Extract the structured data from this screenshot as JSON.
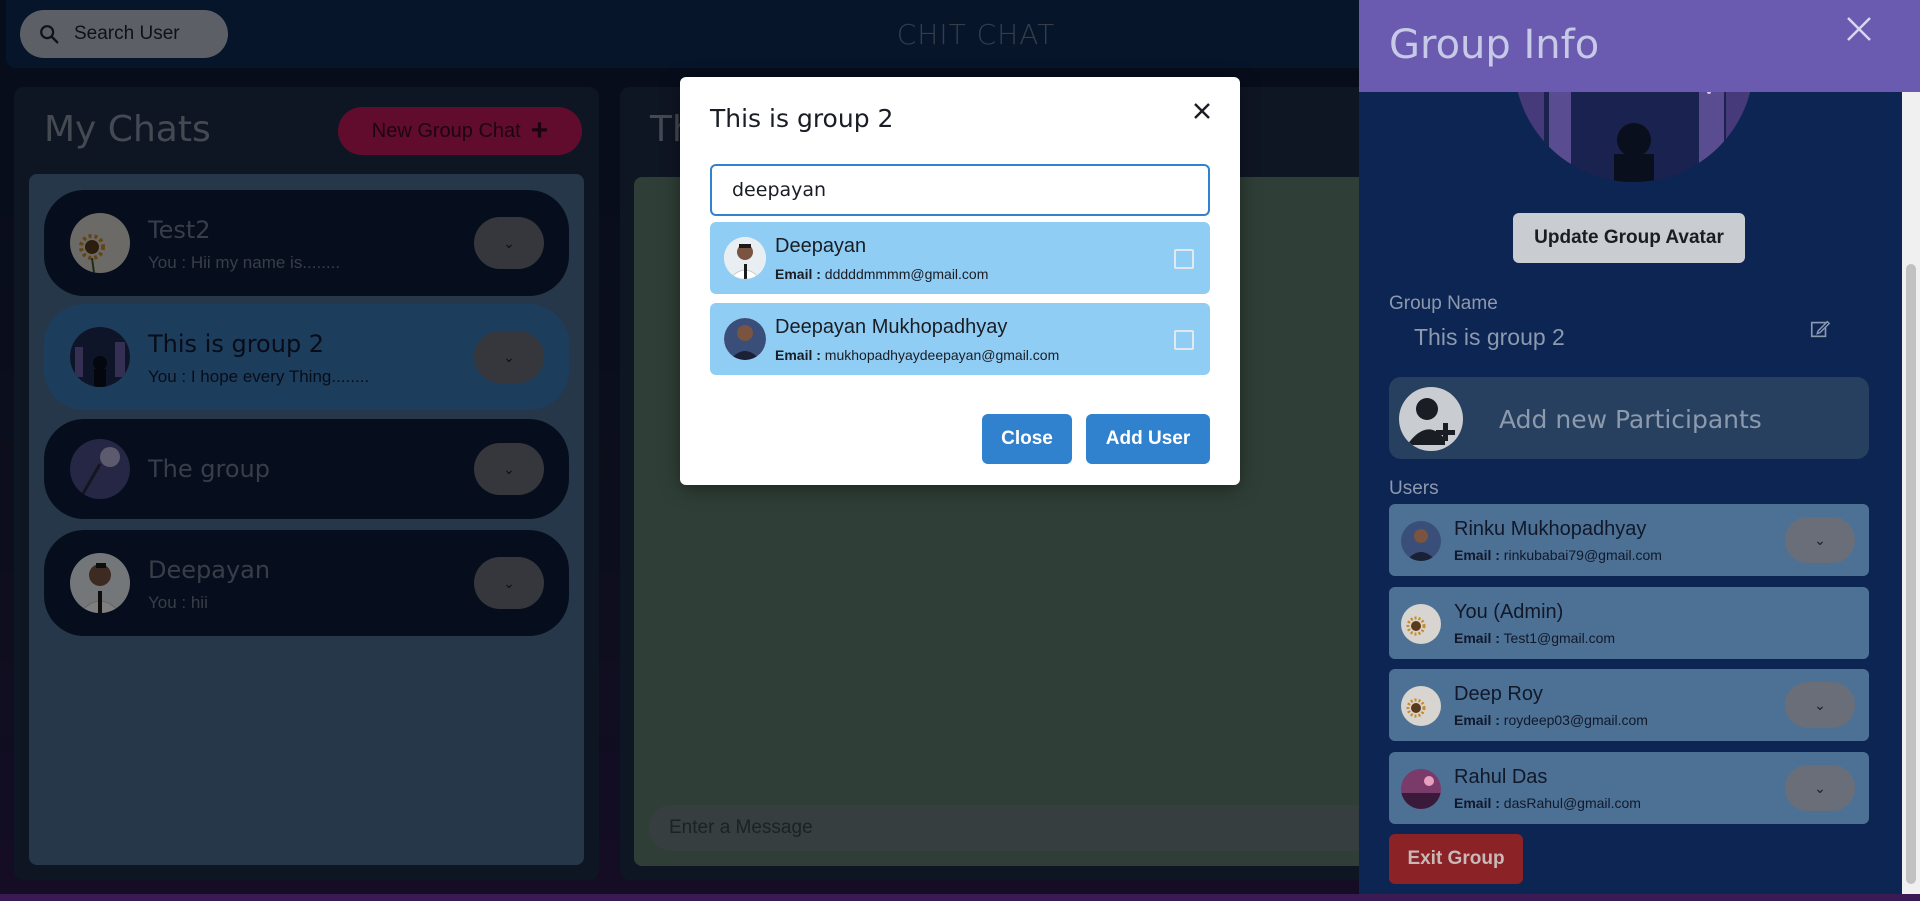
{
  "header": {
    "search_label": "Search User",
    "app_title": "CHIT CHAT"
  },
  "my_chats": {
    "title": "My Chats",
    "new_group_label": "New Group Chat",
    "chats": [
      {
        "name": "Test2",
        "last": "You : Hii my name is........"
      },
      {
        "name": "This is group 2",
        "last": "You : I hope every Thing........"
      },
      {
        "name": "The group",
        "last": ""
      },
      {
        "name": "Deepayan",
        "last": "You : hii"
      }
    ]
  },
  "chat": {
    "title_partial": "Th",
    "message_placeholder": "Enter a Message"
  },
  "drawer": {
    "title": "Group Info",
    "update_avatar_label": "Update Group Avatar",
    "group_name_label": "Group Name",
    "group_name_value": "This is group 2",
    "add_participants_label": "Add new Participants",
    "users_label": "Users",
    "email_prefix": "Email :",
    "users": [
      {
        "name": "Rinku Mukhopadhyay",
        "email": "rinkubabai79@gmail.com"
      },
      {
        "name": "You (Admin)",
        "email": "Test1@gmail.com"
      },
      {
        "name": "Deep Roy",
        "email": "roydeep03@gmail.com"
      },
      {
        "name": "Rahul Das",
        "email": "dasRahul@gmail.com"
      }
    ],
    "exit_label": "Exit Group"
  },
  "modal": {
    "title": "This is group 2",
    "search_value": "deepayan",
    "email_prefix": "Email :",
    "results": [
      {
        "name": "Deepayan",
        "email": "dddddmmmm@gmail.com"
      },
      {
        "name": "Deepayan Mukhopadhyay",
        "email": "mukhopadhyaydeepayan@gmail.com"
      }
    ],
    "close_label": "Close",
    "add_label": "Add User"
  },
  "colors": {
    "accent": "#3182ce",
    "drawer_header": "#6a5bb0",
    "new_group": "#c2185b",
    "exit": "#c53030"
  }
}
